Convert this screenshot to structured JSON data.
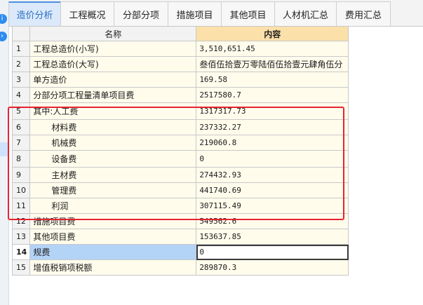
{
  "tabs": [
    {
      "label": "造价分析",
      "active": true
    },
    {
      "label": "工程概况",
      "active": false
    },
    {
      "label": "分部分项",
      "active": false
    },
    {
      "label": "措施项目",
      "active": false
    },
    {
      "label": "其他项目",
      "active": false
    },
    {
      "label": "人材机汇总",
      "active": false
    },
    {
      "label": "费用汇总",
      "active": false
    }
  ],
  "table": {
    "headers": {
      "name": "名称",
      "content": "内容"
    },
    "rows": [
      {
        "no": "1",
        "name": "工程总造价(小写)",
        "value": "3,510,651.45"
      },
      {
        "no": "2",
        "name": "工程总造价(大写)",
        "value": "叁佰伍拾壹万零陆佰伍拾壹元肆角伍分"
      },
      {
        "no": "3",
        "name": "单方造价",
        "value": "169.58"
      },
      {
        "no": "4",
        "name": "分部分项工程量清单项目费",
        "value": "2517580.7"
      },
      {
        "no": "5",
        "name": "其中:人工费",
        "value": "1317317.73"
      },
      {
        "no": "6",
        "name": "材料费",
        "value": "237332.27"
      },
      {
        "no": "7",
        "name": "机械费",
        "value": "219060.8"
      },
      {
        "no": "8",
        "name": "设备费",
        "value": "0"
      },
      {
        "no": "9",
        "name": "主材费",
        "value": "274432.93"
      },
      {
        "no": "10",
        "name": "管理费",
        "value": "441740.69"
      },
      {
        "no": "11",
        "name": "利润",
        "value": "307115.49"
      },
      {
        "no": "12",
        "name": "措施项目费",
        "value": "549562.6"
      },
      {
        "no": "13",
        "name": "其他项目费",
        "value": "153637.85"
      },
      {
        "no": "14",
        "name": "规费",
        "value": "0"
      },
      {
        "no": "15",
        "name": "增值税销项税额",
        "value": "289870.3"
      }
    ]
  },
  "icons": {
    "strip_top": "info-circle-icon",
    "strip_bottom": "chevron-circle-icon"
  },
  "colors": {
    "accent": "#2b6fc2",
    "highlight_box": "#e8232f",
    "header_content": "#fbe0a9",
    "cell_bg": "#fffcec",
    "selected_name": "#b3d3f7"
  }
}
